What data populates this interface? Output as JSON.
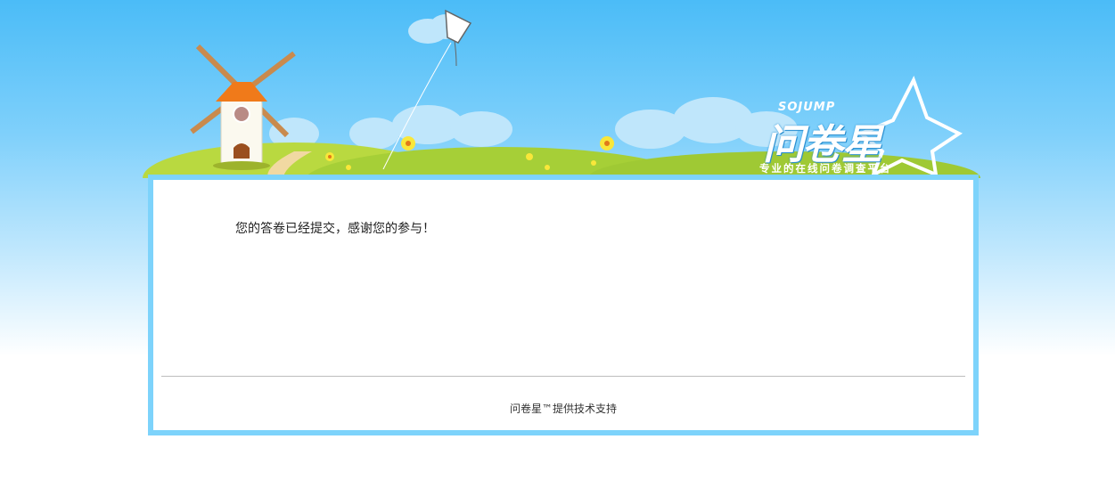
{
  "header": {
    "brand_en": "SOJUMP",
    "brand_cn": "问卷星",
    "tagline": "专业的在线问卷调查平台"
  },
  "main": {
    "message": "您的答卷已经提交，感谢您的参与！"
  },
  "footer": {
    "powered_by": "问卷星™提供技术支持"
  },
  "colors": {
    "sky_top": "#4bbcf7",
    "card_border": "#7dd3fb",
    "grass": "#a6cf37"
  }
}
